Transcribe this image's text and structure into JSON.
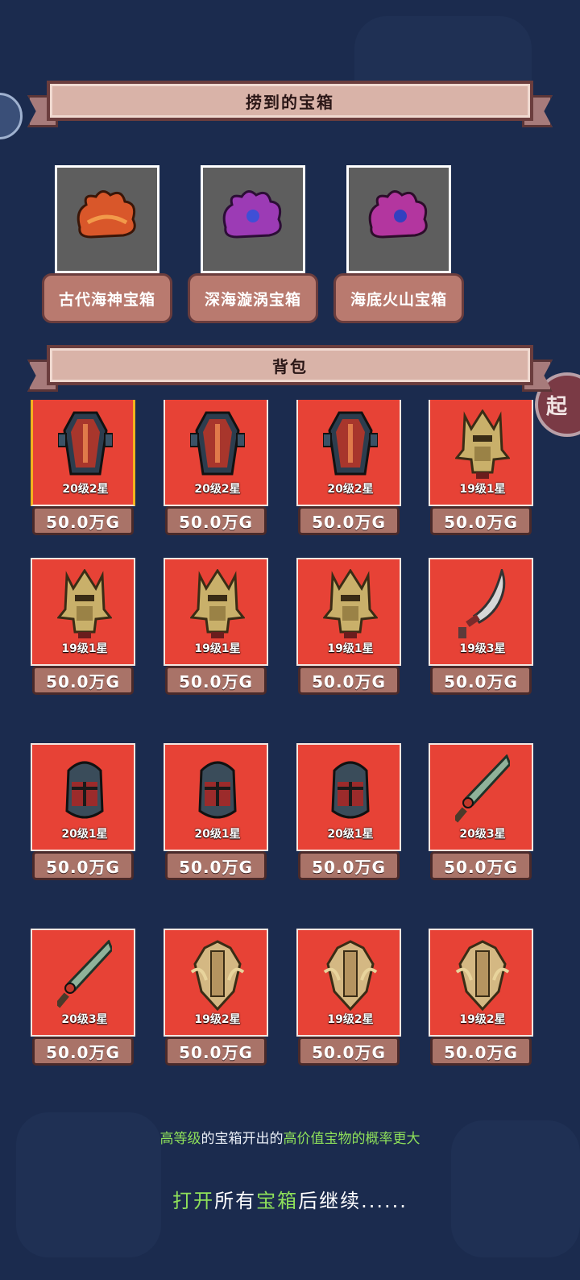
{
  "banners": {
    "caught": "捞到的宝箱",
    "bag": "背包"
  },
  "chests": [
    {
      "name": "古代海神宝箱",
      "icon": "orange-coral-chest-icon",
      "color": "#e0602a"
    },
    {
      "name": "深海漩涡宝箱",
      "icon": "purple-coral-chest-icon",
      "color": "#a040b8"
    },
    {
      "name": "海底火山宝箱",
      "icon": "magenta-coral-chest-icon",
      "color": "#b03aa8"
    }
  ],
  "items": [
    {
      "level": "20级2星",
      "price": "50.0万G",
      "icon": "coffin-shield-icon"
    },
    {
      "level": "20级2星",
      "price": "50.0万G",
      "icon": "coffin-shield-icon"
    },
    {
      "level": "20级2星",
      "price": "50.0万G",
      "icon": "coffin-shield-icon"
    },
    {
      "level": "19级1星",
      "price": "50.0万G",
      "icon": "golden-helmet-icon"
    },
    {
      "level": "19级1星",
      "price": "50.0万G",
      "icon": "golden-helmet-icon"
    },
    {
      "level": "19级1星",
      "price": "50.0万G",
      "icon": "golden-helmet-icon"
    },
    {
      "level": "19级1星",
      "price": "50.0万G",
      "icon": "golden-helmet-icon"
    },
    {
      "level": "19级3星",
      "price": "50.0万G",
      "icon": "curved-blade-icon"
    },
    {
      "level": "20级1星",
      "price": "50.0万G",
      "icon": "knight-helmet-icon"
    },
    {
      "level": "20级1星",
      "price": "50.0万G",
      "icon": "knight-helmet-icon"
    },
    {
      "level": "20级1星",
      "price": "50.0万G",
      "icon": "knight-helmet-icon"
    },
    {
      "level": "20级3星",
      "price": "50.0万G",
      "icon": "jade-sword-icon"
    },
    {
      "level": "20级3星",
      "price": "50.0万G",
      "icon": "jade-sword-icon"
    },
    {
      "level": "19级2星",
      "price": "50.0万G",
      "icon": "golden-crest-icon"
    },
    {
      "level": "19级2星",
      "price": "50.0万G",
      "icon": "golden-crest-icon"
    },
    {
      "level": "19级2星",
      "price": "50.0万G",
      "icon": "golden-crest-icon"
    }
  ],
  "hint": {
    "p1": "高等级",
    "p2": "的宝箱开出的",
    "p3": "高价值宝物的概率更大"
  },
  "continue": {
    "p1": "打开",
    "p2": "所有",
    "p3": "宝箱",
    "p4": "后继续......"
  },
  "side": {
    "right_button": "起"
  },
  "colors": {
    "card": "#e74236",
    "highlight": "#8ee05a",
    "selected": "#f3b21d"
  }
}
